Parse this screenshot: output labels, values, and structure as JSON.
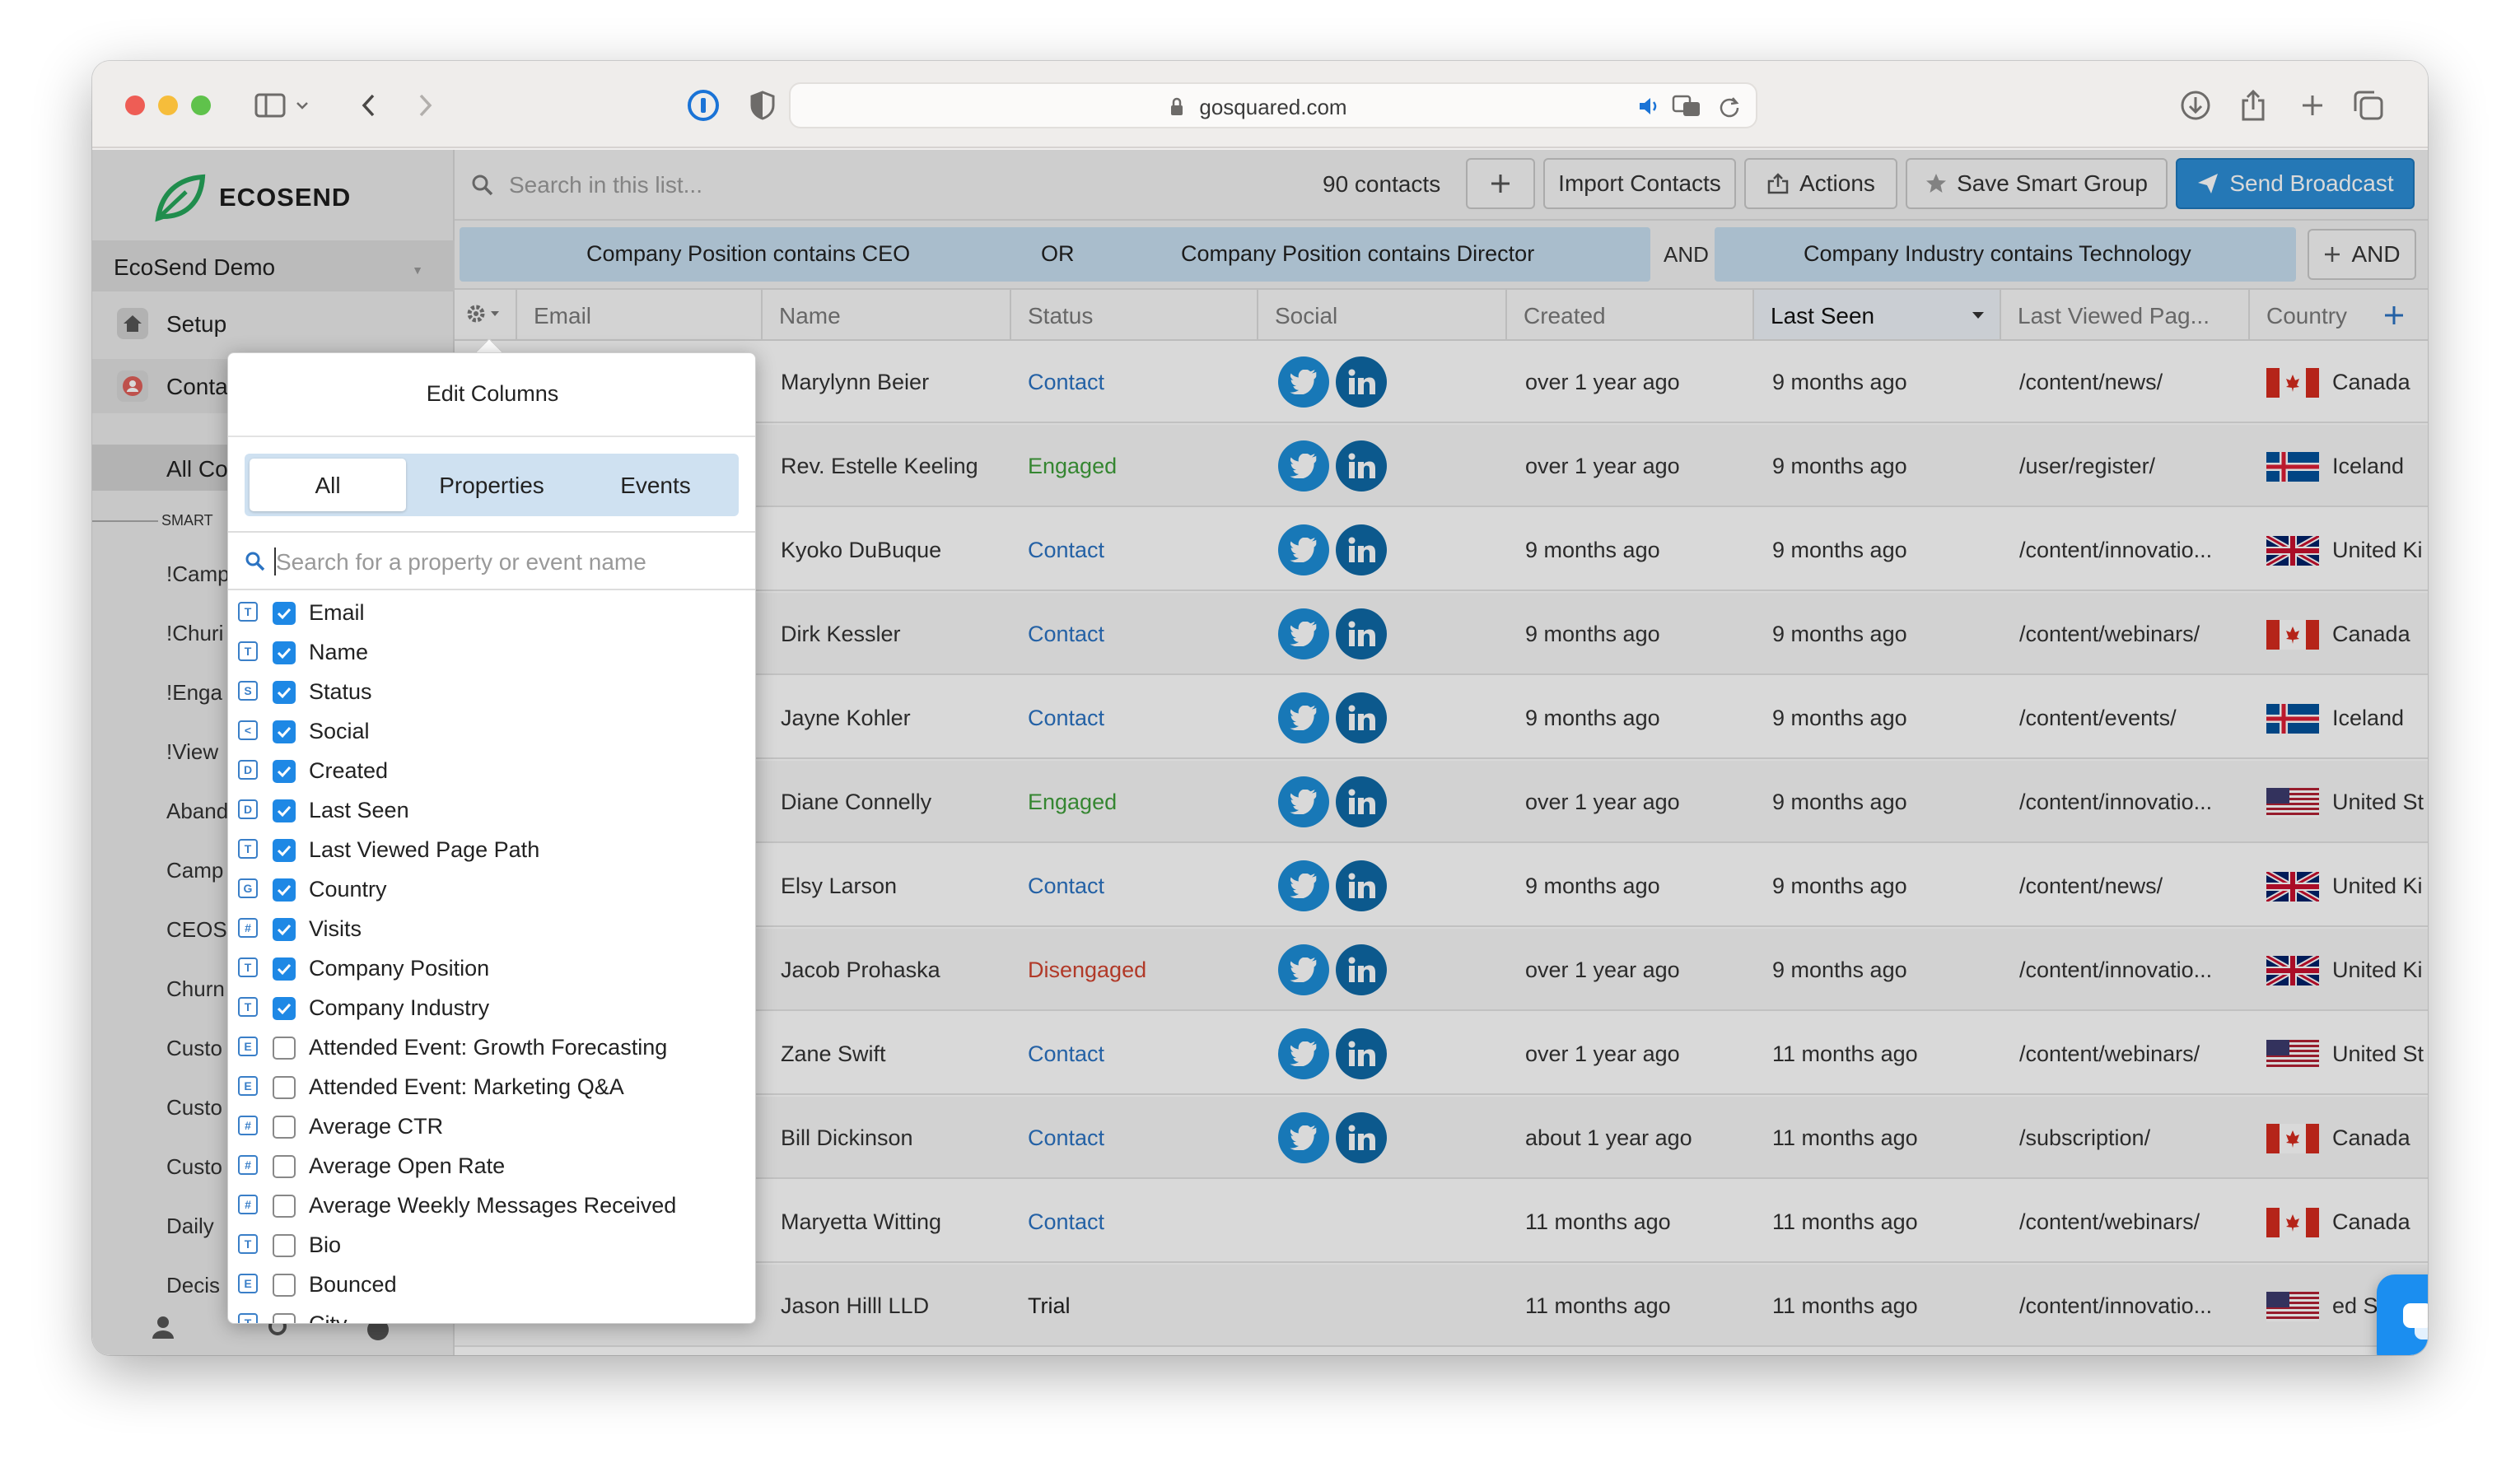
{
  "browser": {
    "url": "gosquared.com"
  },
  "sidebar": {
    "brand": "ECOSEND",
    "workspace": "EcoSend Demo",
    "nav": [
      {
        "label": "Setup"
      },
      {
        "label": "Conta"
      }
    ],
    "all_contacts": "All Co",
    "smart_label": "SMART",
    "groups": [
      "!Camp",
      "!Churi",
      "!Enga",
      "!View",
      "Aband",
      "Camp",
      "CEOS",
      "Churn",
      "Custo",
      "Custo",
      "Custo",
      "Daily",
      "Decis"
    ]
  },
  "toolbar": {
    "search_placeholder": "Search in this list...",
    "count": "90 contacts",
    "import_label": "Import Contacts",
    "actions_label": "Actions",
    "save_label": "Save Smart Group",
    "send_label": "Send Broadcast"
  },
  "filters": {
    "f1": "Company Position contains CEO",
    "or": "OR",
    "f2": "Company Position contains Director",
    "and": "AND",
    "f3": "Company Industry contains Technology",
    "add_and": "AND"
  },
  "table": {
    "columns": [
      "Email",
      "Name",
      "Status",
      "Social",
      "Created",
      "Last Seen",
      "Last Viewed Pag...",
      "Country"
    ],
    "rows": [
      {
        "name": "Marylynn Beier",
        "status": "Contact",
        "social": true,
        "created": "over 1 year ago",
        "last_seen": "9 months ago",
        "page": "/content/news/",
        "country": "Canada",
        "flag": "ca"
      },
      {
        "name": "Rev. Estelle Keeling",
        "status": "Engaged",
        "social": true,
        "created": "over 1 year ago",
        "last_seen": "9 months ago",
        "page": "/user/register/",
        "country": "Iceland",
        "flag": "is"
      },
      {
        "name": "Kyoko DuBuque",
        "status": "Contact",
        "social": true,
        "created": "9 months ago",
        "last_seen": "9 months ago",
        "page": "/content/innovatio...",
        "country": "United Ki",
        "flag": "uk"
      },
      {
        "name": "Dirk Kessler",
        "status": "Contact",
        "social": true,
        "created": "9 months ago",
        "last_seen": "9 months ago",
        "page": "/content/webinars/",
        "country": "Canada",
        "flag": "ca"
      },
      {
        "name": "Jayne Kohler",
        "status": "Contact",
        "social": true,
        "created": "9 months ago",
        "last_seen": "9 months ago",
        "page": "/content/events/",
        "country": "Iceland",
        "flag": "is"
      },
      {
        "name": "Diane Connelly",
        "status": "Engaged",
        "social": true,
        "created": "over 1 year ago",
        "last_seen": "9 months ago",
        "page": "/content/innovatio...",
        "country": "United St",
        "flag": "us"
      },
      {
        "name": "Elsy Larson",
        "status": "Contact",
        "social": true,
        "created": "9 months ago",
        "last_seen": "9 months ago",
        "page": "/content/news/",
        "country": "United Ki",
        "flag": "uk"
      },
      {
        "name": "Jacob Prohaska",
        "status": "Disengaged",
        "social": true,
        "created": "over 1 year ago",
        "last_seen": "9 months ago",
        "page": "/content/innovatio...",
        "country": "United Ki",
        "flag": "uk"
      },
      {
        "name": "Zane Swift",
        "status": "Contact",
        "social": true,
        "created": "over 1 year ago",
        "last_seen": "11 months ago",
        "page": "/content/webinars/",
        "country": "United St",
        "flag": "us"
      },
      {
        "name": "Bill Dickinson",
        "status": "Contact",
        "social": true,
        "created": "about 1 year ago",
        "last_seen": "11 months ago",
        "page": "/subscription/",
        "country": "Canada",
        "flag": "ca"
      },
      {
        "name": "Maryetta Witting",
        "status": "Contact",
        "social": false,
        "created": "11 months ago",
        "last_seen": "11 months ago",
        "page": "/content/webinars/",
        "country": "Canada",
        "flag": "ca"
      },
      {
        "name": "Jason Hilll LLD",
        "status": "Trial",
        "social": false,
        "created": "11 months ago",
        "last_seen": "11 months ago",
        "page": "/content/innovatio...",
        "country": "ed St",
        "flag": "us"
      }
    ]
  },
  "popup": {
    "title": "Edit Columns",
    "tabs": [
      "All",
      "Properties",
      "Events"
    ],
    "search_placeholder": "Search for a property or event name",
    "items": [
      {
        "label": "Email",
        "checked": true,
        "type": "T"
      },
      {
        "label": "Name",
        "checked": true,
        "type": "T"
      },
      {
        "label": "Status",
        "checked": true,
        "type": "S"
      },
      {
        "label": "Social",
        "checked": true,
        "type": "<"
      },
      {
        "label": "Created",
        "checked": true,
        "type": "D"
      },
      {
        "label": "Last Seen",
        "checked": true,
        "type": "D"
      },
      {
        "label": "Last Viewed Page Path",
        "checked": true,
        "type": "T"
      },
      {
        "label": "Country",
        "checked": true,
        "type": "G"
      },
      {
        "label": "Visits",
        "checked": true,
        "type": "#"
      },
      {
        "label": "Company Position",
        "checked": true,
        "type": "T"
      },
      {
        "label": "Company Industry",
        "checked": true,
        "type": "T"
      },
      {
        "label": "Attended Event: Growth Forecasting",
        "checked": false,
        "type": "E"
      },
      {
        "label": "Attended Event: Marketing Q&A",
        "checked": false,
        "type": "E"
      },
      {
        "label": "Average CTR",
        "checked": false,
        "type": "#"
      },
      {
        "label": "Average Open Rate",
        "checked": false,
        "type": "#"
      },
      {
        "label": "Average Weekly Messages Received",
        "checked": false,
        "type": "#"
      },
      {
        "label": "Bio",
        "checked": false,
        "type": "T"
      },
      {
        "label": "Bounced",
        "checked": false,
        "type": "E"
      },
      {
        "label": "City",
        "checked": false,
        "type": "T"
      }
    ]
  }
}
